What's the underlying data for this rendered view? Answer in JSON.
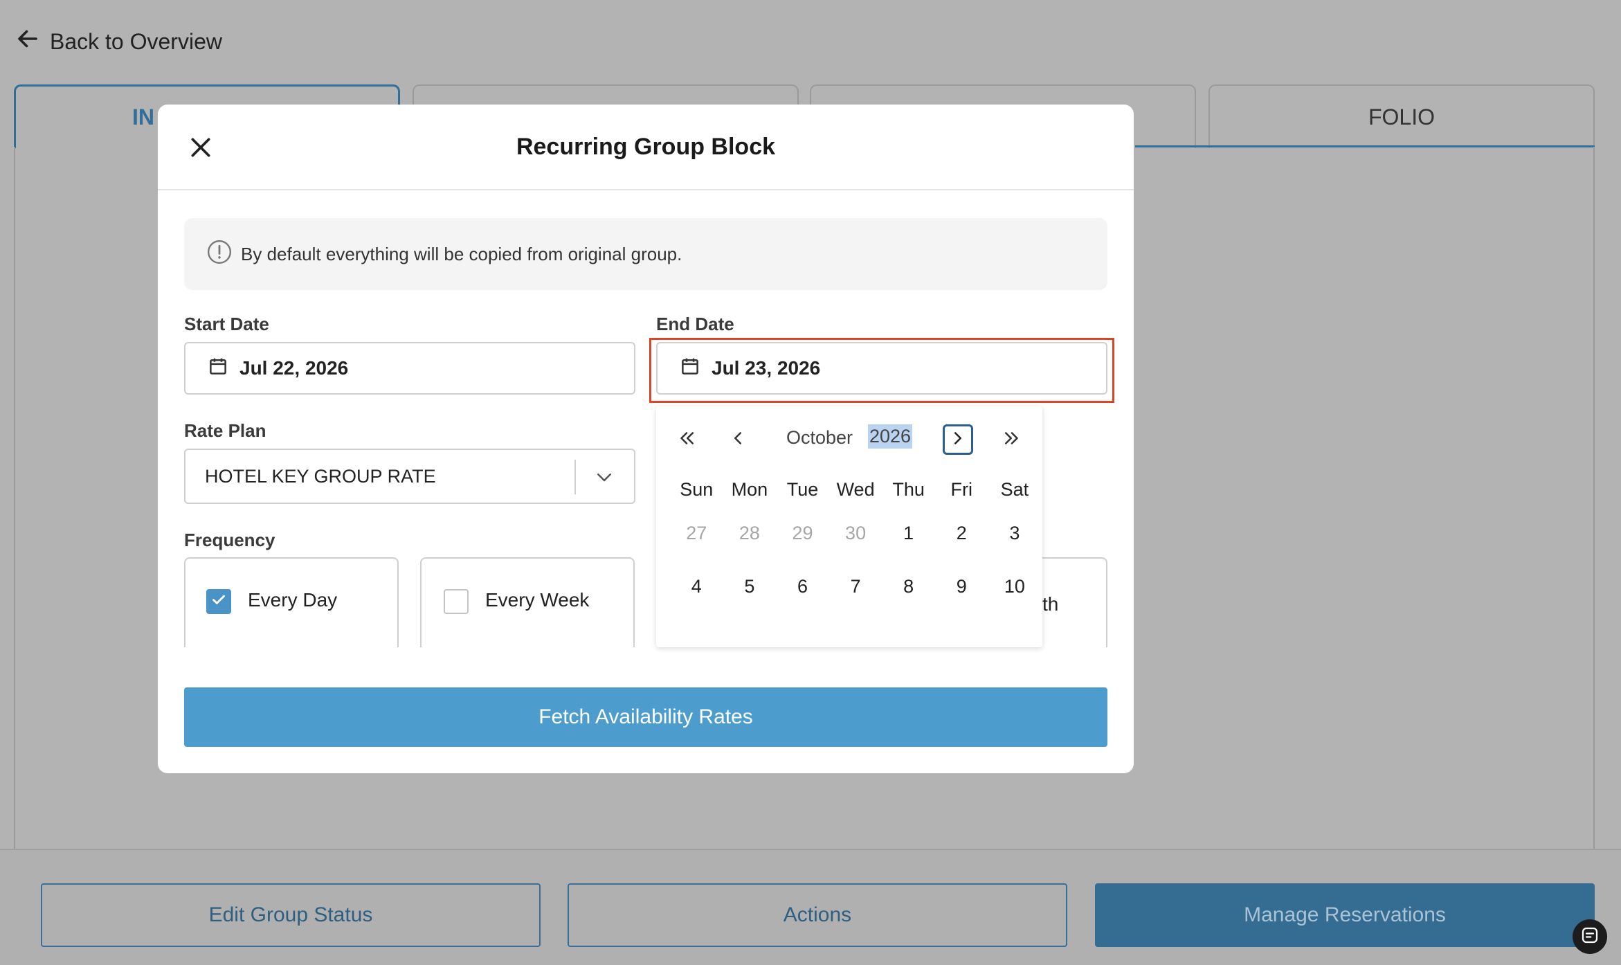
{
  "page": {
    "back_label": "Back to Overview",
    "tabs": [
      {
        "label": "IN"
      },
      {
        "label": ""
      },
      {
        "label": ""
      },
      {
        "label": "FOLIO"
      }
    ]
  },
  "footer": {
    "edit_status_label": "Edit Group Status",
    "actions_label": "Actions",
    "manage_label": "Manage Reservations"
  },
  "modal": {
    "title": "Recurring Group Block",
    "info_text": "By default everything will be copied from original group.",
    "start_date": {
      "label": "Start Date",
      "value": "Jul 22, 2026"
    },
    "end_date": {
      "label": "End Date",
      "value": "Jul 23, 2026"
    },
    "rate_plan": {
      "label": "Rate Plan",
      "value": "HOTEL KEY GROUP RATE"
    },
    "frequency": {
      "label": "Frequency",
      "options": [
        {
          "label": "Every Day",
          "checked": true
        },
        {
          "label": "Every Week",
          "checked": false
        },
        {
          "label": "th",
          "checked": false
        }
      ]
    },
    "calendar": {
      "month": "October",
      "year": "2026",
      "weekdays": [
        "Sun",
        "Mon",
        "Tue",
        "Wed",
        "Thu",
        "Fri",
        "Sat"
      ],
      "weeks": [
        [
          {
            "d": "27",
            "muted": true
          },
          {
            "d": "28",
            "muted": true
          },
          {
            "d": "29",
            "muted": true
          },
          {
            "d": "30",
            "muted": true
          },
          {
            "d": "1"
          },
          {
            "d": "2"
          },
          {
            "d": "3"
          }
        ],
        [
          {
            "d": "4"
          },
          {
            "d": "5"
          },
          {
            "d": "6"
          },
          {
            "d": "7"
          },
          {
            "d": "8"
          },
          {
            "d": "9"
          },
          {
            "d": "10"
          }
        ]
      ]
    },
    "fetch_label": "Fetch Availability Rates"
  },
  "colors": {
    "primary": "#4c9ccd",
    "highlight_border": "#d9452b",
    "overlay": "#b3b3b3"
  }
}
